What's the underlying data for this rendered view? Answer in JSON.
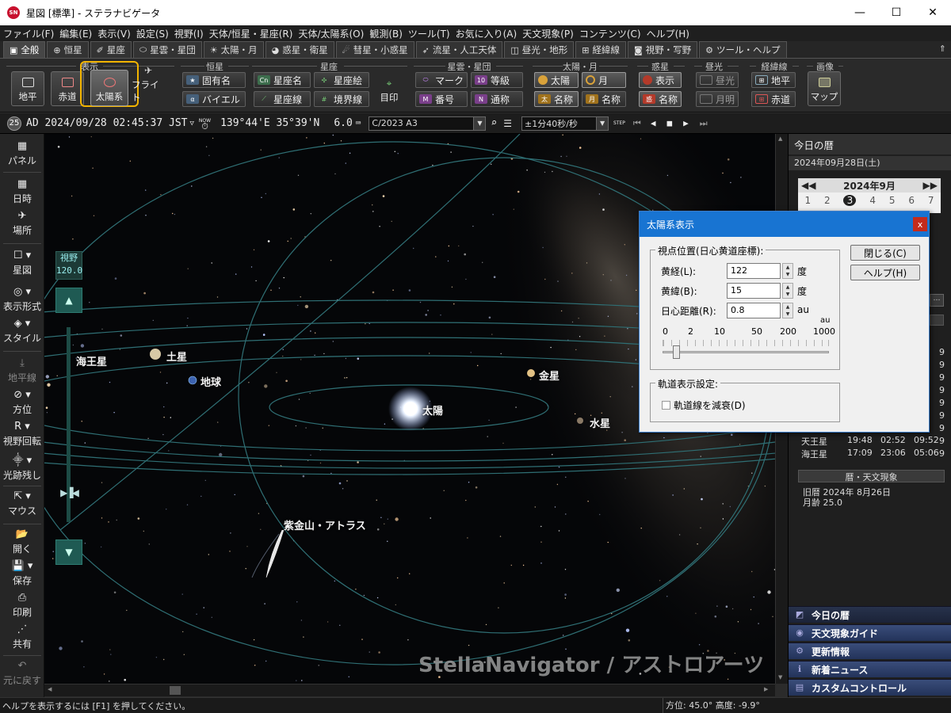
{
  "window": {
    "title": "星図 [標準] - ステラナビゲータ",
    "app_badge": "SN",
    "min": "—",
    "max": "☐",
    "close": "✕"
  },
  "menu": [
    "ファイル(F)",
    "編集(E)",
    "表示(V)",
    "設定(S)",
    "視野(I)",
    "天体/恒星・星座(R)",
    "天体/太陽系(O)",
    "観測(B)",
    "ツール(T)",
    "お気に入り(A)",
    "天文現象(P)",
    "コンテンツ(C)",
    "ヘルプ(H)"
  ],
  "tabs": [
    {
      "icon": "▣",
      "label": "全般"
    },
    {
      "icon": "⊕",
      "label": "恒星"
    },
    {
      "icon": "✐",
      "label": "星座"
    },
    {
      "icon": "⬭",
      "label": "星雲・星団"
    },
    {
      "icon": "☀",
      "label": "太陽・月"
    },
    {
      "icon": "◕",
      "label": "惑星・衛星"
    },
    {
      "icon": "☄",
      "label": "彗星・小惑星"
    },
    {
      "icon": "➶",
      "label": "流星・人工天体"
    },
    {
      "icon": "◫",
      "label": "昼光・地形"
    },
    {
      "icon": "⊞",
      "label": "経緯線"
    },
    {
      "icon": "◙",
      "label": "視野・写野"
    },
    {
      "icon": "⚙",
      "label": "ツール・ヘルプ"
    }
  ],
  "pin_icon": "⇑",
  "ribbon": {
    "groups": [
      "表示",
      "恒星",
      "星座",
      "星雲・星団",
      "太陽・月",
      "惑星",
      "昼光",
      "経緯線",
      "画像"
    ],
    "display": [
      "地平",
      "赤道",
      "太陽系",
      "フライト"
    ],
    "star": [
      "固有名",
      "バイエル"
    ],
    "constellation": [
      "星座名",
      "星座絵",
      "星座線",
      "境界線",
      "目印"
    ],
    "nebula": [
      "マーク",
      "等級",
      "番号",
      "通称"
    ],
    "sunmoon": [
      "太陽",
      "月",
      "名称",
      "名称"
    ],
    "planet": [
      "表示",
      "名称"
    ],
    "daylight": [
      "昼光",
      "月明"
    ],
    "grid": [
      "地平",
      "赤道"
    ],
    "image": [
      "マップ"
    ]
  },
  "status": {
    "badge": "25",
    "datetime": "AD 2024/09/28 02:45:37 JST",
    "now": "NOW",
    "location": "139°44'E 35°39'N",
    "magnitude": "6.0",
    "object": "C/2023 A3",
    "speed": "±1分40秒/秒",
    "step": "STEP"
  },
  "sidebar": [
    {
      "icon": "▦",
      "label": "パネル"
    },
    {
      "icon": "▦",
      "label": "日時"
    },
    {
      "icon": "✈",
      "label": "場所"
    },
    {
      "icon": "☐ ▾",
      "label": "星図"
    },
    {
      "icon": "◎ ▾",
      "label": "表示形式"
    },
    {
      "icon": "◈ ▾",
      "label": "スタイル"
    },
    {
      "icon": "⤓",
      "label": "地平線"
    },
    {
      "icon": "⊘ ▾",
      "label": "方位"
    },
    {
      "icon": "R ▾",
      "label": "視野回転"
    },
    {
      "icon": "⸎ ▾",
      "label": "光跡残し"
    },
    {
      "icon": "⇱ ▾",
      "label": "マウス"
    },
    {
      "icon": "📂",
      "label": "開く"
    },
    {
      "icon": "💾 ▾",
      "label": "保存"
    },
    {
      "icon": "⎙",
      "label": "印刷"
    },
    {
      "icon": "⋰",
      "label": "共有"
    },
    {
      "icon": "↶",
      "label": "元に戻す"
    }
  ],
  "fov": {
    "label": "視野",
    "value": "120.0"
  },
  "sky_labels": [
    "海王星",
    "土星",
    "地球",
    "金星",
    "太陽",
    "水星",
    "紫金山・アトラス"
  ],
  "watermark": "StellaNavigator / アストロアーツ",
  "right_panel": {
    "header": "今日の暦",
    "date": "2024年09月28日(土)",
    "cal_month": "2024年9月",
    "cal_days": [
      "1",
      "2",
      "3",
      "4",
      "5",
      "6",
      "7"
    ],
    "bodies": [
      {
        "name": "天王星",
        "rise": "19:48",
        "transit": "02:52",
        "set": "09:52"
      },
      {
        "name": "海王星",
        "rise": "17:09",
        "transit": "23:06",
        "set": "05:06"
      }
    ],
    "partial_rows": [
      "9",
      "9",
      "9",
      "9",
      "9",
      "9",
      "9",
      "9",
      "9"
    ],
    "calendar_section": "暦・天文現象",
    "lunar": "旧暦 2024年 8月26日",
    "moon_age": "月齢 25.0",
    "bottom": [
      {
        "icon": "◩",
        "label": "今日の暦"
      },
      {
        "icon": "◉",
        "label": "天文現象ガイド"
      },
      {
        "icon": "⚙",
        "label": "更新情報"
      },
      {
        "icon": "ℹ",
        "label": "新着ニュース"
      },
      {
        "icon": "▤",
        "label": "カスタムコントロール"
      }
    ]
  },
  "dialog": {
    "title": "太陽系表示",
    "close": "x",
    "viewpoint_legend": "視点位置(日心黄道座標):",
    "ecl_lon_label": "黄経(L):",
    "ecl_lon": "122",
    "deg1": "度",
    "ecl_lat_label": "黄緯(B):",
    "ecl_lat": "15",
    "deg2": "度",
    "dist_label": "日心距離(R):",
    "dist": "0.8",
    "au": "au",
    "scale_unit": "au",
    "scale_ticks": [
      "0",
      "2",
      "10",
      "50",
      "200",
      "1000"
    ],
    "close_btn": "閉じる(C)",
    "help_btn": "ヘルプ(H)",
    "orbit_legend": "軌道表示設定:",
    "fade_label": "軌道線を減衰(D)"
  },
  "statusbar": {
    "help": "ヘルプを表示するには [F1] を押してください。",
    "az": "方位:  45.0°  高度:  -9.9°"
  }
}
